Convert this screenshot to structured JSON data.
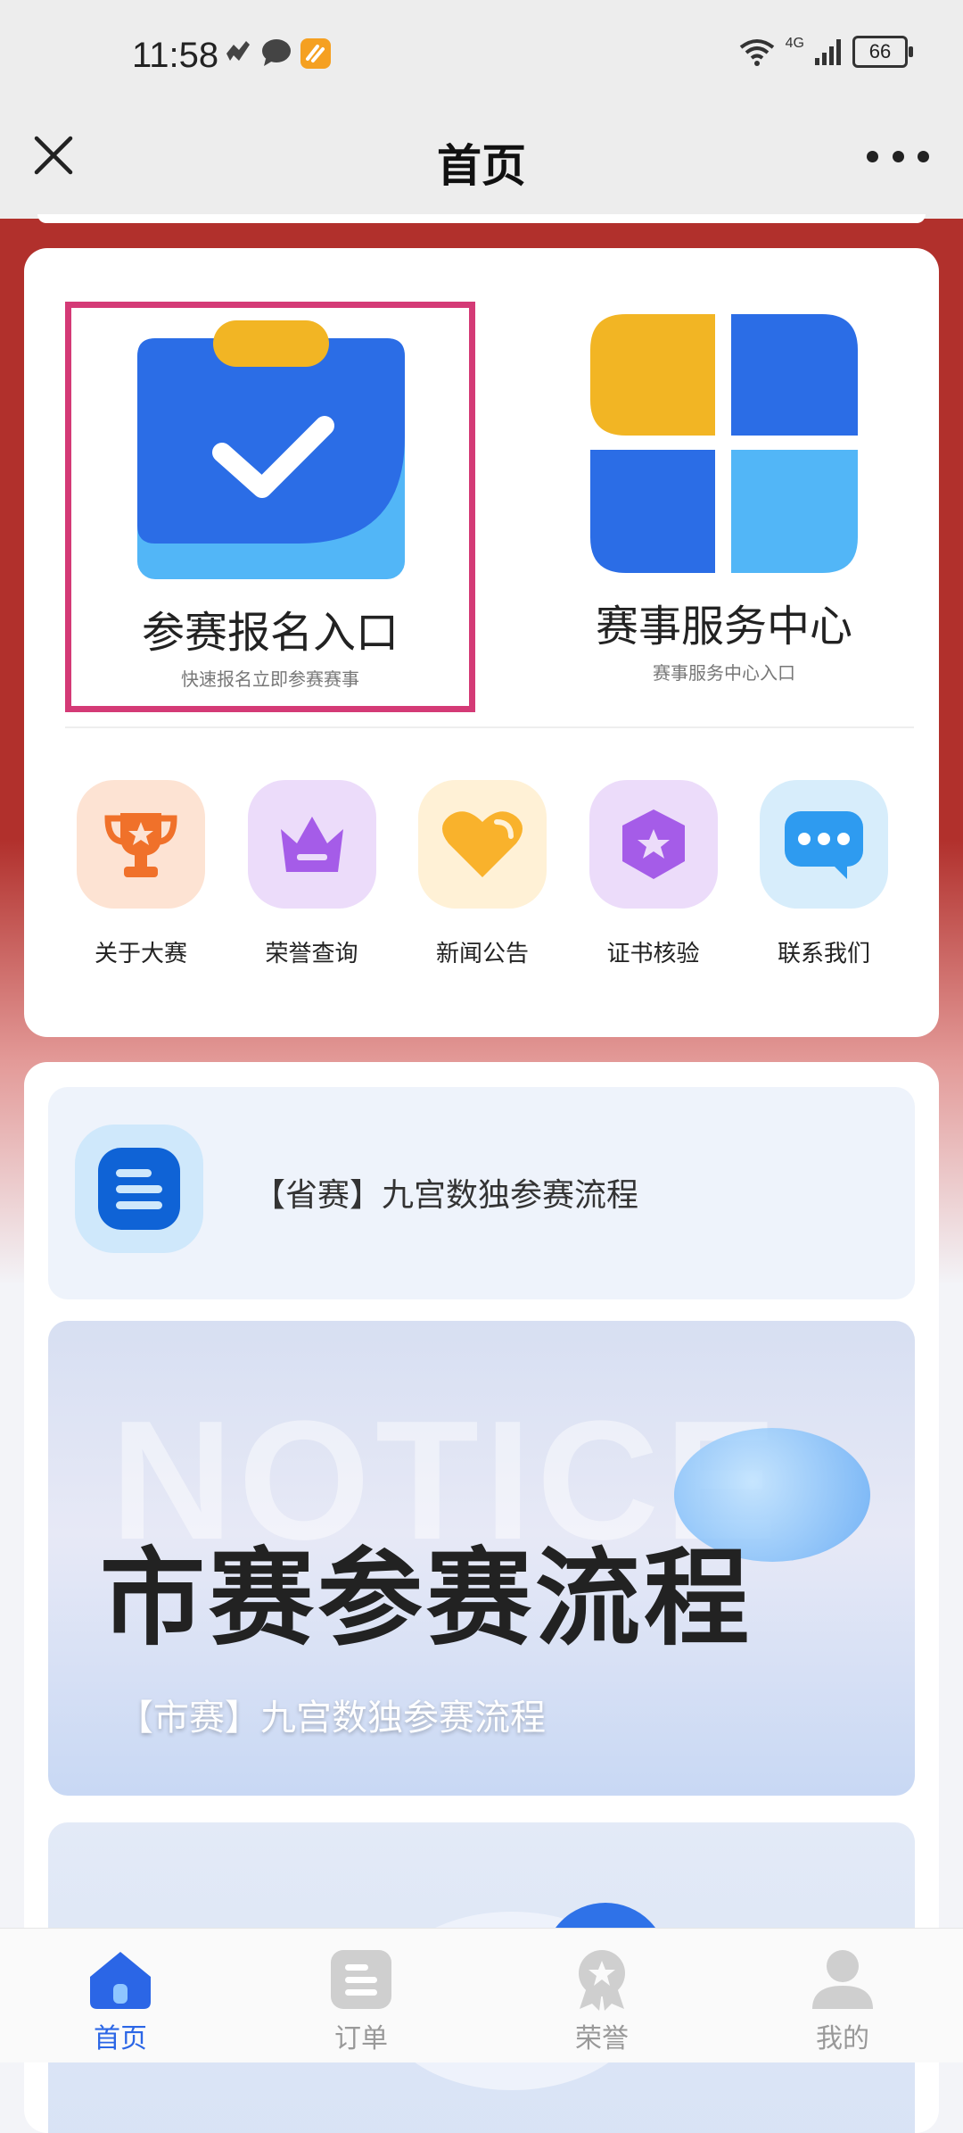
{
  "status_bar": {
    "time": "11:58",
    "battery": "66",
    "network": "4G"
  },
  "nav": {
    "title": "首页"
  },
  "entries": [
    {
      "title": "参赛报名入口",
      "subtitle": "快速报名立即参赛赛事"
    },
    {
      "title": "赛事服务中心",
      "subtitle": "赛事服务中心入口"
    }
  ],
  "quick_links": [
    {
      "label": "关于大赛",
      "icon": "trophy-icon"
    },
    {
      "label": "荣誉查询",
      "icon": "crown-icon"
    },
    {
      "label": "新闻公告",
      "icon": "heart-icon"
    },
    {
      "label": "证书核验",
      "icon": "star-badge-icon"
    },
    {
      "label": "联系我们",
      "icon": "chat-icon"
    }
  ],
  "news": {
    "title": "【省赛】九宫数独参赛流程"
  },
  "banner": {
    "watermark": "NOTICE",
    "title": "市赛参赛流程",
    "subtitle": "【市赛】九宫数独参赛流程"
  },
  "tabs": [
    {
      "label": "首页",
      "active": true
    },
    {
      "label": "订单",
      "active": false
    },
    {
      "label": "荣誉",
      "active": false
    },
    {
      "label": "我的",
      "active": false
    }
  ],
  "colors": {
    "accent": "#2b66e6",
    "highlight": "#d43a76",
    "header_red": "#b1302c"
  }
}
